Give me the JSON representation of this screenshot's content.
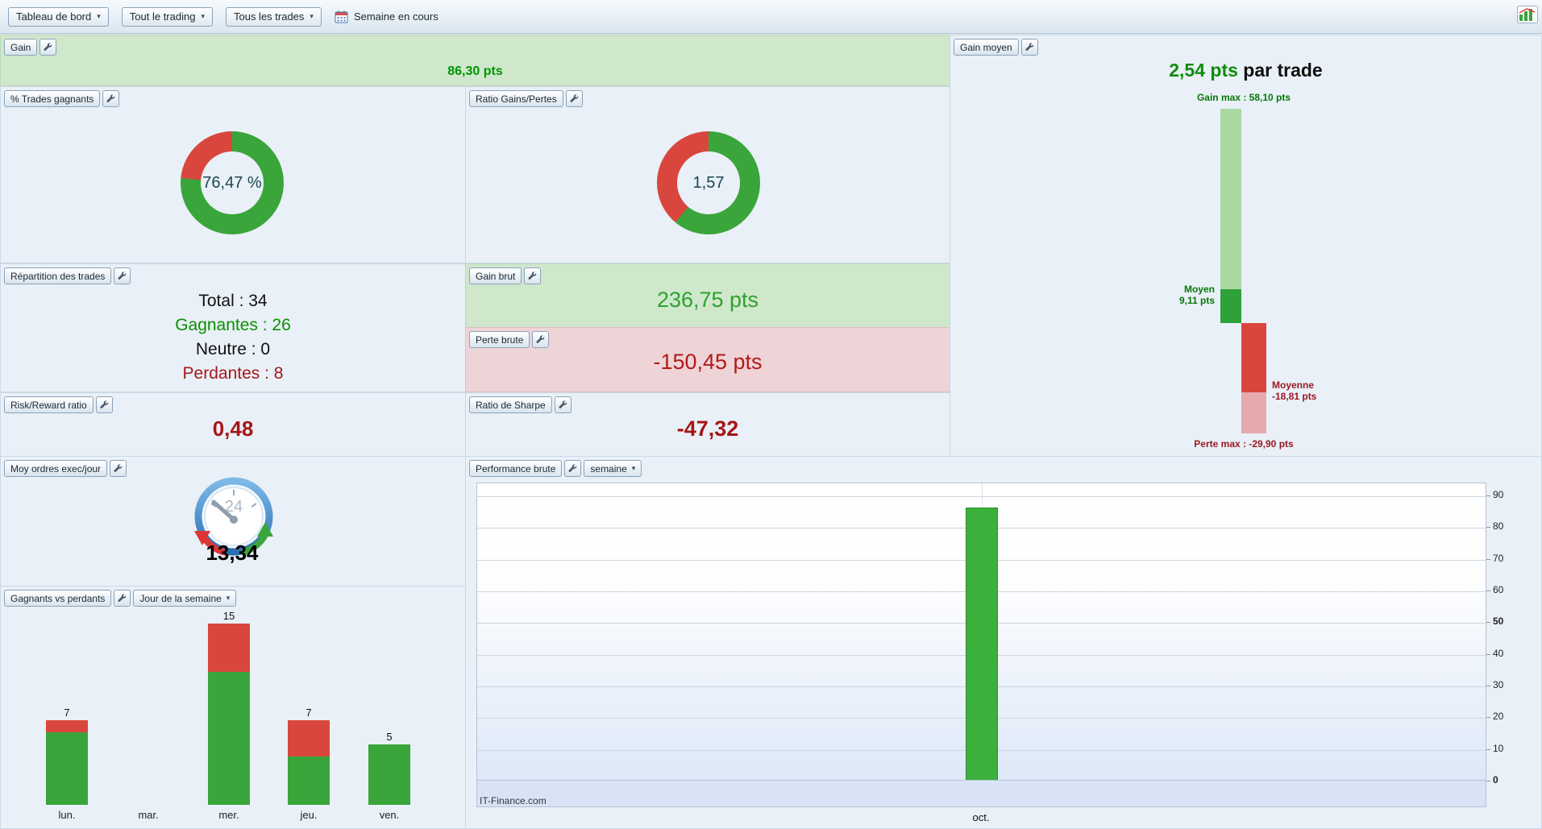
{
  "toolbar": {
    "dashboard_dropdown": "Tableau de bord",
    "trading_scope_dropdown": "Tout le trading",
    "trades_filter_dropdown": "Tous les trades",
    "period_label": "Semaine en cours"
  },
  "colors": {
    "green": "#3aa53a",
    "red": "#d9463d",
    "light_green": "#a9d8a3",
    "dark_green": "#2fa139",
    "light_red": "#e6aaae",
    "green_text": "#009400",
    "dark_red_text": "#a51818",
    "gain_panel_bg": "#cfe8cc",
    "loss_panel_bg": "#eed3d7"
  },
  "panels": {
    "gain": {
      "title": "Gain",
      "value": "86,30 pts"
    },
    "pct_winning": {
      "title": "% Trades gagnants",
      "value": "76,47 %",
      "percent": 76.47
    },
    "ratio_gains_pertes": {
      "title": "Ratio Gains/Pertes",
      "value": "1,57",
      "ratio": 1.57
    },
    "repartition": {
      "title": "Répartition des trades",
      "total": "Total : 34",
      "winners": "Gagnantes : 26",
      "neutral": "Neutre : 0",
      "losers": "Perdantes : 8"
    },
    "gain_brut": {
      "title": "Gain brut",
      "value": "236,75 pts"
    },
    "perte_brute": {
      "title": "Perte brute",
      "value": "-150,45 pts"
    },
    "risk_reward": {
      "title": "Risk/Reward ratio",
      "value": "0,48"
    },
    "sharpe": {
      "title": "Ratio de Sharpe",
      "value": "-47,32"
    },
    "gain_moyen": {
      "title": "Gain moyen",
      "headline_value": "2,54 pts",
      "headline_suffix": " par trade",
      "gain_max_label": "Gain max : 58,10 pts",
      "moyen_label": "Moyen",
      "moyen_value": "9,11 pts",
      "moyenne_label": "Moyenne",
      "moyenne_value": "-18,81 pts",
      "perte_max_label": "Perte max : -29,90 pts",
      "chart": {
        "type": "floating-bar",
        "gain_max": 58.1,
        "moyen": 9.11,
        "moyenne": -18.81,
        "perte_max": -29.9
      }
    },
    "moy_ordres": {
      "title": "Moy ordres exec/jour",
      "value": "13,34",
      "gauge_label": "24"
    },
    "gagnants_perdants": {
      "title": "Gagnants vs perdants",
      "dropdown": "Jour de la semaine",
      "chart": {
        "type": "stacked-bar",
        "categories": [
          "lun.",
          "mar.",
          "mer.",
          "jeu.",
          "ven."
        ],
        "series": [
          {
            "name": "gagnants",
            "color": "#3aa53a",
            "values": [
              6,
              0,
              11,
              4,
              5
            ]
          },
          {
            "name": "perdants",
            "color": "#d9463d",
            "values": [
              1,
              0,
              4,
              3,
              0
            ]
          }
        ],
        "totals": [
          7,
          0,
          15,
          7,
          5
        ]
      }
    },
    "performance": {
      "title": "Performance brute",
      "dropdown": "semaine",
      "watermark": "IT-Finance.com",
      "chart": {
        "type": "bar",
        "categories": [
          "oct."
        ],
        "values": [
          86.3
        ],
        "ylim": [
          0,
          90
        ],
        "yticks": [
          0,
          10,
          20,
          30,
          40,
          50,
          60,
          70,
          80,
          90
        ],
        "bold_ticks": [
          0,
          50
        ],
        "bar_color": "#3cb03c"
      }
    }
  }
}
